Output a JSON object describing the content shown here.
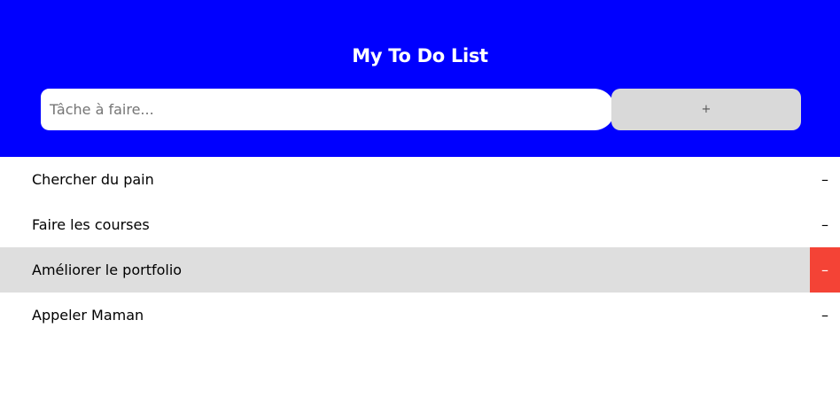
{
  "header": {
    "title": "My To Do List",
    "input_placeholder": "Tâche à faire...",
    "input_value": "",
    "add_label": "+"
  },
  "tasks": [
    {
      "label": "Chercher du pain",
      "remove_label": "–",
      "highlighted": false
    },
    {
      "label": "Faire les courses",
      "remove_label": "–",
      "highlighted": false
    },
    {
      "label": "Améliorer le portfolio",
      "remove_label": "–",
      "highlighted": true
    },
    {
      "label": "Appeler Maman",
      "remove_label": "–",
      "highlighted": false
    }
  ],
  "colors": {
    "header_background": "#0000ff",
    "add_button_background": "#d9d9d9",
    "highlight_row": "#dedede",
    "remove_hover": "#f44336"
  }
}
